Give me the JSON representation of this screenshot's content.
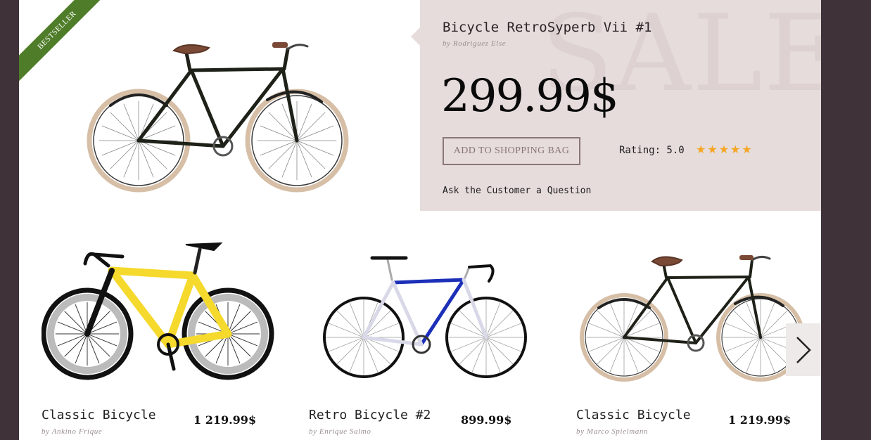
{
  "ribbon": {
    "label": "BESTSELLER",
    "color": "#4e7c28"
  },
  "featured": {
    "title": "Bicycle RetroSyperb Vii #1",
    "author": "by Rodriguez Else",
    "price": "299.99$",
    "watermark": "SALE",
    "add_button_label": "ADD TO SHOPPING BAG",
    "rating_label": "Rating: 5.0",
    "rating_value": 5,
    "rating_max": 5,
    "ask_link": "Ask the Customer a Question",
    "panel_color": "#e6dcdb"
  },
  "products": [
    {
      "name": "Classic Bicycle",
      "author": "by Ankino Frique",
      "price": "1 219.99$",
      "frame_color": "#f5d92c"
    },
    {
      "name": "Retro Bicycle #2",
      "author": "by Enrique Salmo",
      "price": "899.99$",
      "frame_color": "#1c2fb8"
    },
    {
      "name": "Classic Bicycle",
      "author": "by Marco Spielmann",
      "price": "1 219.99$",
      "frame_color": "#1a1a1a"
    }
  ],
  "nav": {
    "next_icon": "chevron-right-icon"
  },
  "colors": {
    "background": "#3f3339",
    "star": "#f5a623",
    "button_border": "#8a7678"
  }
}
